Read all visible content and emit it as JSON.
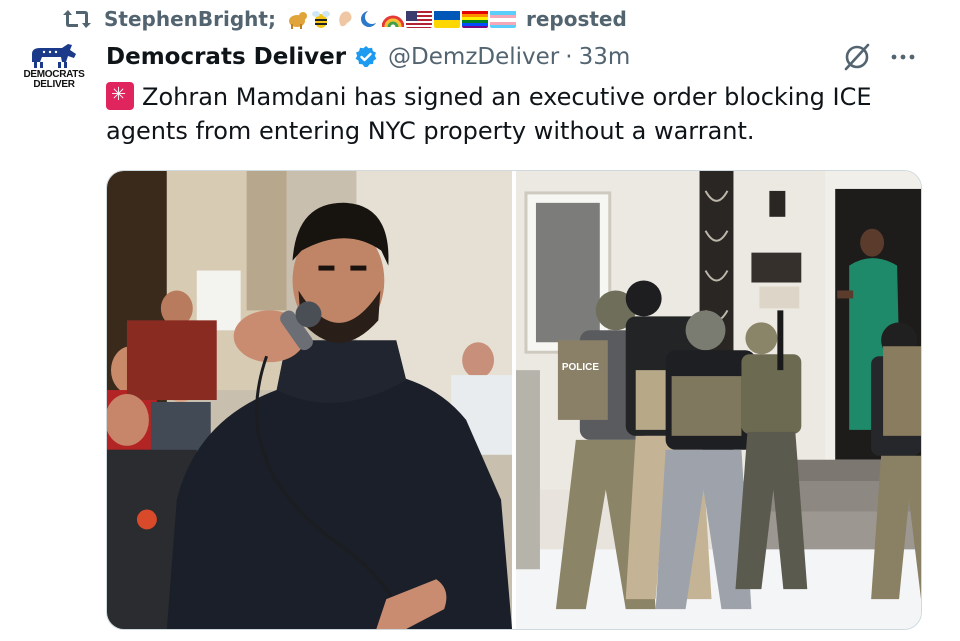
{
  "repost": {
    "icon": "repost-icon",
    "user": "StephenBright;",
    "emoji_icons": [
      "dog-emoji-icon",
      "bee-emoji-icon",
      "ear-emoji-icon",
      "moon-emoji-icon",
      "rainbow-emoji-icon",
      "us-flag-icon",
      "ukraine-flag-icon",
      "pride-flag-icon",
      "trans-flag-icon"
    ],
    "label": "reposted"
  },
  "author": {
    "avatar_text_line1": "DEMOCRATS",
    "avatar_text_line2": "DELIVER",
    "display_name": "Democrats Deliver",
    "handle": "@DemzDeliver",
    "separator": "·",
    "time": "33m",
    "verified_color": "#1d9bf0"
  },
  "tweet": {
    "siren_icon": "siren-icon",
    "text": "Zohran Mamdani has signed an executive order blocking ICE agents from entering NYC property without a warrant."
  },
  "media": {
    "left_photo": "man-speaking-into-microphone-photo",
    "right_photo": "agents-at-house-door-photo",
    "vest_label": "POLICE"
  },
  "colors": {
    "text_primary": "#0f1419",
    "text_secondary": "#536471",
    "border": "#cfd9de",
    "brand_blue": "#1d9bf0"
  }
}
